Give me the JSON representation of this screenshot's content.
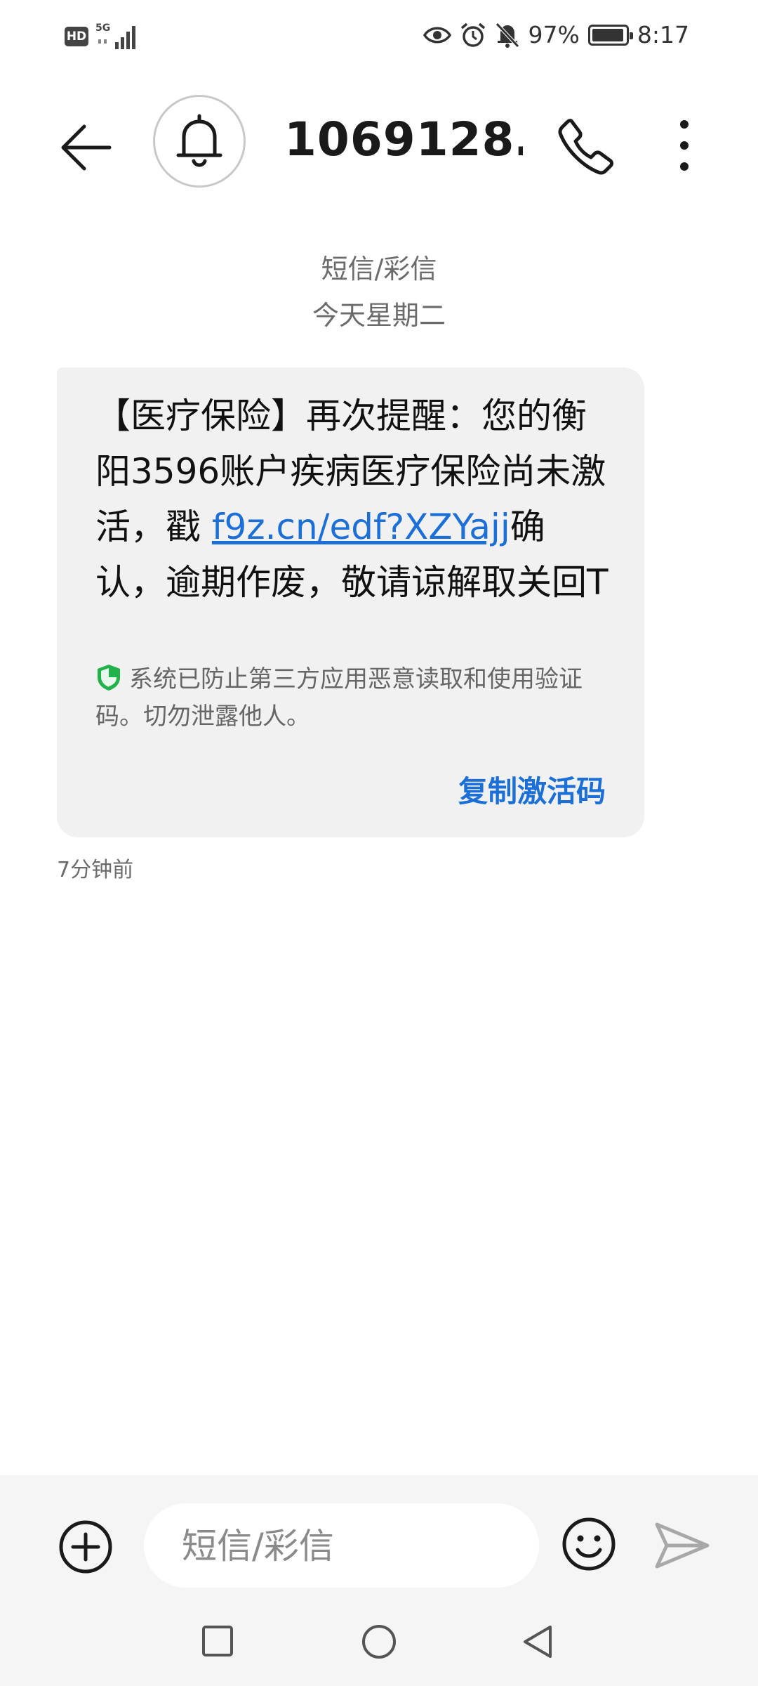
{
  "status_bar": {
    "hd_label": "HD",
    "network_type": "5G",
    "battery_percent": "97%",
    "battery_level": 0.97,
    "time": "8:17",
    "icons": [
      "eye-icon",
      "alarm-icon",
      "mute-bell-icon",
      "battery-icon"
    ]
  },
  "header": {
    "contact_number": "1069128…",
    "icons": [
      "back-arrow-icon",
      "bell-avatar-icon",
      "phone-icon",
      "more-vertical-icon"
    ]
  },
  "conversation": {
    "message_type": "短信/彩信",
    "date_label": "今天星期二"
  },
  "message": {
    "text_before_link": "【医疗保险】再次提醒：您的衡阳3596账户疾病医疗保险尚未激活，戳 ",
    "link": "f9z.cn/edf?XZYajj",
    "text_after_link": "确认，逾期作废，敬请谅解取关回T",
    "security_notice": "系统已防止第三方应用恶意读取和使用验证码。切勿泄露他人。",
    "copy_action": "复制激活码",
    "time_ago": "7分钟前"
  },
  "compose": {
    "placeholder": "短信/彩信",
    "value": ""
  },
  "colors": {
    "link": "#1b6fd6",
    "bubble": "#f1f1f1",
    "shield": "#22b24c"
  }
}
